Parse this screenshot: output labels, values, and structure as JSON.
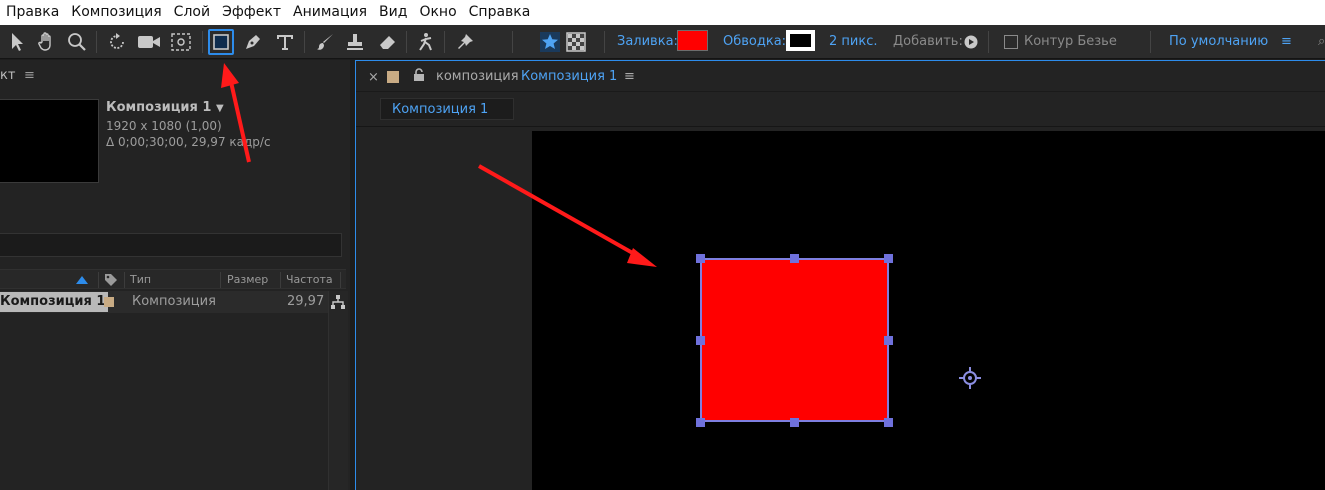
{
  "menu": [
    "Правка",
    "Композиция",
    "Слой",
    "Эффект",
    "Анимация",
    "Вид",
    "Окно",
    "Справка"
  ],
  "toolbar": {
    "tools": [
      "selection-tool",
      "hand-tool",
      "zoom-tool",
      "rotation-tool",
      "camera-tool",
      "pan-behind-tool",
      "rectangle-tool",
      "pen-tool",
      "type-tool",
      "brush-tool",
      "clone-stamp-tool",
      "eraser-tool",
      "roto-brush-tool",
      "puppet-pin-tool"
    ],
    "active_tool": "rectangle-tool",
    "fill_label": "Заливка:",
    "fill_color": "#ff0000",
    "stroke_label": "Обводка:",
    "stroke_width": "2 пикс.",
    "add_label": "Добавить:",
    "bezier_label": "Контур Безье",
    "workspace": "По умолчанию",
    "accent": "#4ea3f4"
  },
  "project": {
    "tab_fragment": "кт",
    "comp_name": "Композиция 1",
    "comp_size": "1920 x 1080 (1,00)",
    "comp_duration": "Δ 0;00;30;00, 29,97 кадр/с",
    "columns": {
      "type": "Тип",
      "size": "Размер",
      "rate": "Частота ..."
    },
    "items": [
      {
        "name": "Композиция 1",
        "type": "Композиция",
        "rate": "29,97",
        "label_color": "#c8ab84"
      }
    ]
  },
  "viewer": {
    "close": "×",
    "prefix": "композиция",
    "name": "Композиция 1",
    "chip": "Композиция 1",
    "layer_fill": "#ff0000",
    "handle_color": "#6f71dc"
  },
  "annotation_color": "#ff1a1a"
}
